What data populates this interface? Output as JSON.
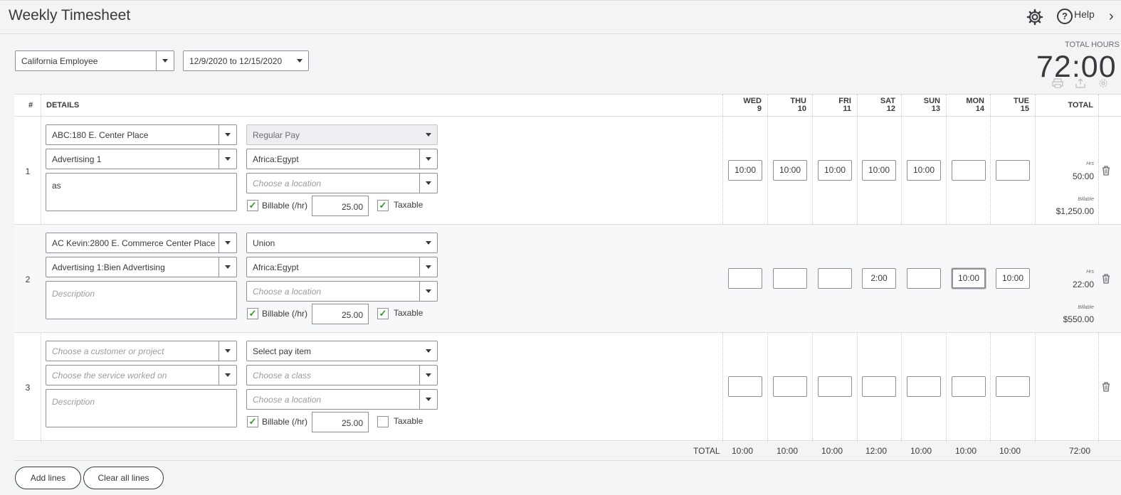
{
  "header": {
    "title": "Weekly Timesheet",
    "help_label": "Help"
  },
  "filters": {
    "employee": "California Employee",
    "date_range": "12/9/2020 to 12/15/2020"
  },
  "total_hours": {
    "label": "TOTAL HOURS",
    "value": "72:00"
  },
  "table": {
    "col_num": "#",
    "col_details": "DETAILS",
    "days": [
      {
        "d": "WED",
        "n": "9"
      },
      {
        "d": "THU",
        "n": "10"
      },
      {
        "d": "FRI",
        "n": "11"
      },
      {
        "d": "SAT",
        "n": "12"
      },
      {
        "d": "SUN",
        "n": "13"
      },
      {
        "d": "MON",
        "n": "14"
      },
      {
        "d": "TUE",
        "n": "15"
      }
    ],
    "col_total": "TOTAL",
    "hrs_label": "Hrs",
    "billable_small": "Billable",
    "rows": [
      {
        "num": "1",
        "customer": "ABC:180 E. Center Place",
        "service": "Advertising 1",
        "description": "as",
        "pay_item": "Regular Pay",
        "class": "Africa:Egypt",
        "location": "Choose a location",
        "billable_label": "Billable (/hr)",
        "rate": "25.00",
        "taxable_label": "Taxable",
        "hours": [
          "10:00",
          "10:00",
          "10:00",
          "10:00",
          "10:00",
          "",
          ""
        ],
        "total_hrs": "50:00",
        "total_billable": "$1,250.00"
      },
      {
        "num": "2",
        "customer": "AC Kevin:2800 E. Commerce Center Place",
        "service": "Advertising 1:Bien Advertising",
        "description": "Description",
        "pay_item": "Union",
        "class": "Africa:Egypt",
        "location": "Choose a location",
        "billable_label": "Billable (/hr)",
        "rate": "25.00",
        "taxable_label": "Taxable",
        "hours": [
          "",
          "",
          "",
          "2:00",
          "",
          "10:00",
          "10:00"
        ],
        "total_hrs": "22:00",
        "total_billable": "$550.00"
      },
      {
        "num": "3",
        "customer": "Choose a customer or project",
        "service": "Choose the service worked on",
        "description": "Description",
        "pay_item": "Select pay item",
        "class": "Choose a class",
        "location": "Choose a location",
        "billable_label": "Billable (/hr)",
        "rate": "25.00",
        "taxable_label": "Taxable",
        "hours": [
          "",
          "",
          "",
          "",
          "",
          "",
          ""
        ]
      }
    ],
    "footer": {
      "label": "TOTAL",
      "days": [
        "10:00",
        "10:00",
        "10:00",
        "12:00",
        "10:00",
        "10:00",
        "10:00"
      ],
      "total": "72:00"
    }
  },
  "buttons": {
    "add_lines": "Add lines",
    "clear_all": "Clear all lines"
  },
  "colors": {
    "accent_green": "#2ca01c",
    "border": "#8d9096"
  }
}
